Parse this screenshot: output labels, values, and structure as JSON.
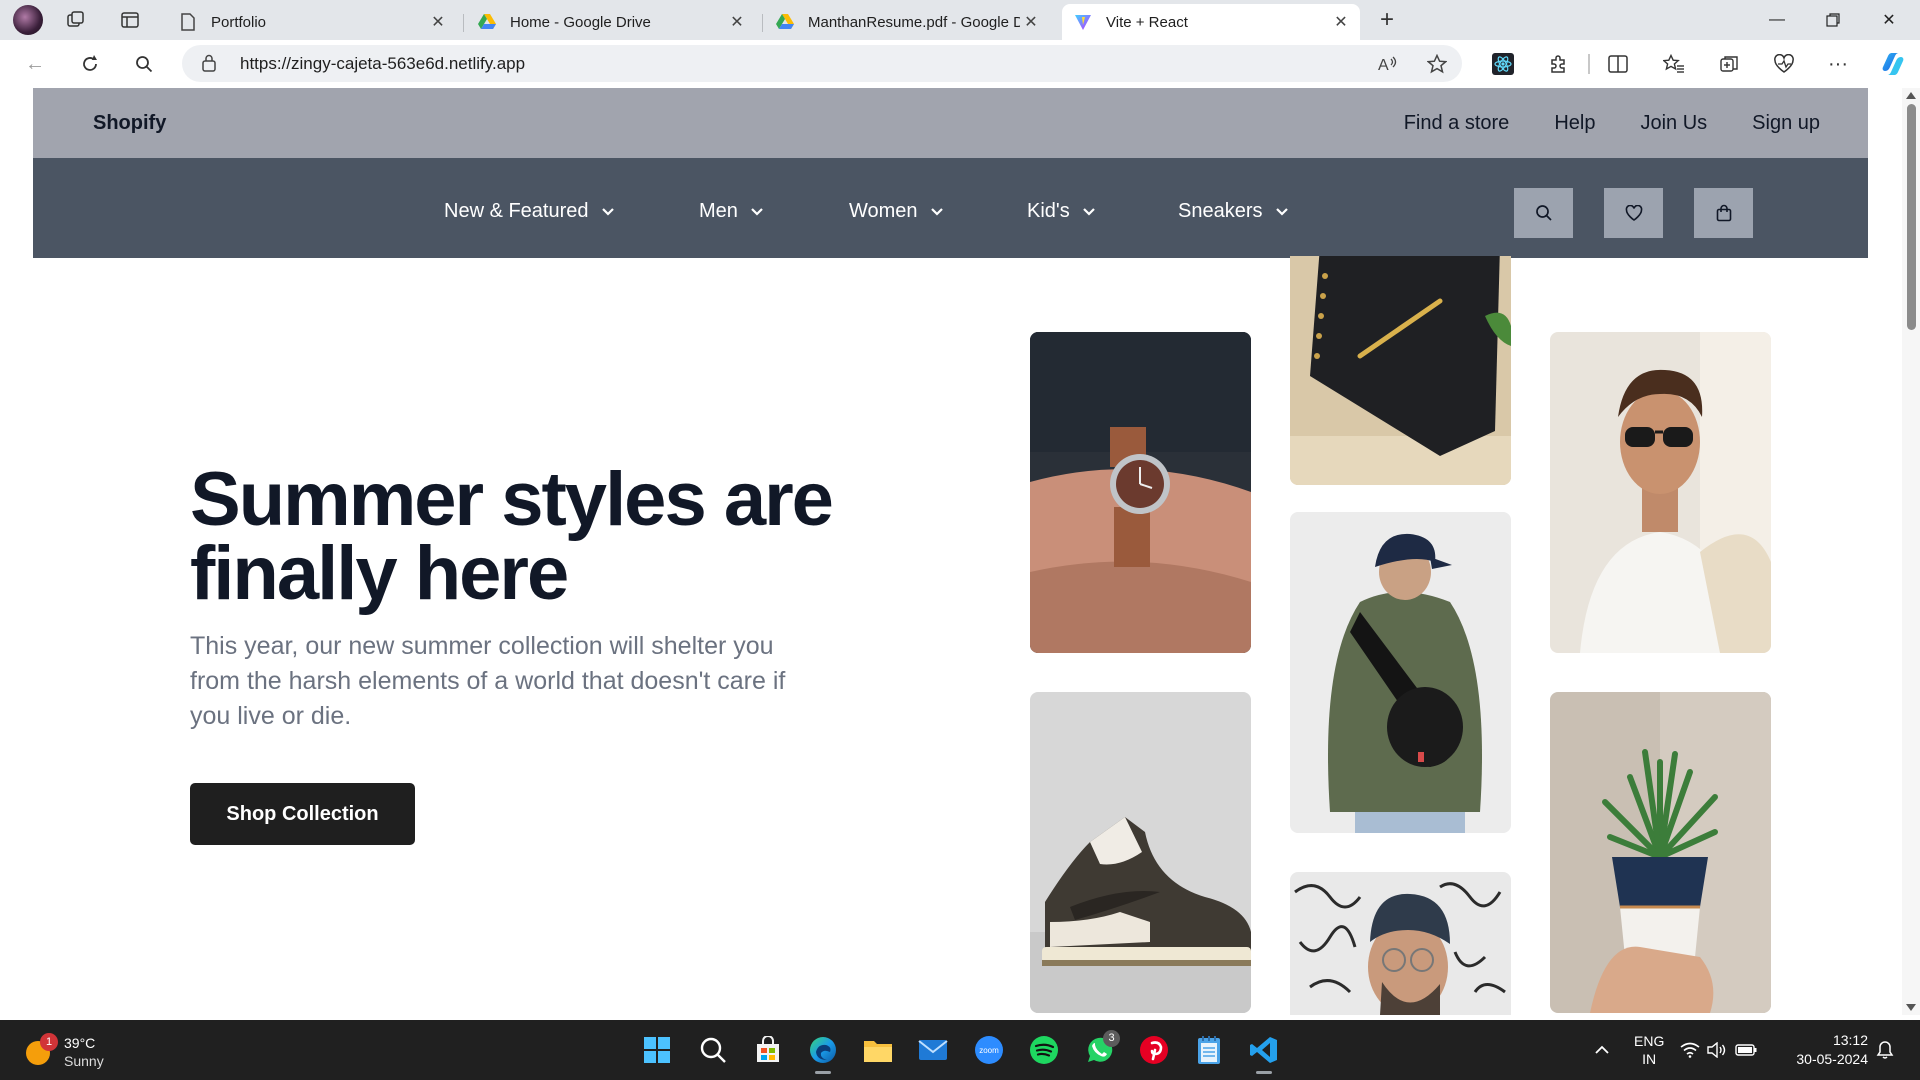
{
  "browser": {
    "tabs": [
      {
        "title": "Portfolio",
        "favicon": "page-icon"
      },
      {
        "title": "Home - Google Drive",
        "favicon": "google-drive-icon"
      },
      {
        "title": "ManthanResume.pdf - Google Drive",
        "favicon": "google-drive-icon"
      },
      {
        "title": "Vite + React",
        "favicon": "vite-icon",
        "active": true
      }
    ],
    "url_host": "https://zingy-cajeta-563e6d.netlify.app",
    "colors": {
      "tabstrip": "#e3e6ea",
      "urlbox": "#eef0f3"
    }
  },
  "site": {
    "brand": "Shopify",
    "top_links": [
      "Find a store",
      "Help",
      "Join Us",
      "Sign up"
    ],
    "nav_items": [
      "New & Featured",
      "Men",
      "Women",
      "Kid's",
      "Sneakers"
    ],
    "hero": {
      "title_line1": "Summer styles are",
      "title_line2": "finally here",
      "text": "This year, our new summer collection will shelter you from the harsh elements of a world that doesn't care if you live or die.",
      "cta_label": "Shop Collection"
    },
    "gallery": [
      "wristwatch",
      "notebook-with-pen",
      "man-in-sunglasses",
      "person-with-backpack",
      "sneaker",
      "potted-succulent",
      "man-in-beanie"
    ],
    "colors": {
      "topbar": "#a1a4ae",
      "nav": "#4b5563",
      "nav_button": "#9ca3af",
      "title": "#111827",
      "body_text": "#6b7280",
      "cta": "#1f1f1f"
    }
  },
  "taskbar": {
    "weather_badge": "1",
    "temperature": "39°C",
    "condition": "Sunny",
    "whatsapp_badge": "3",
    "lang_1": "ENG",
    "lang_2": "IN",
    "time": "13:12",
    "date": "30-05-2024",
    "zoom_label": "zoom"
  }
}
